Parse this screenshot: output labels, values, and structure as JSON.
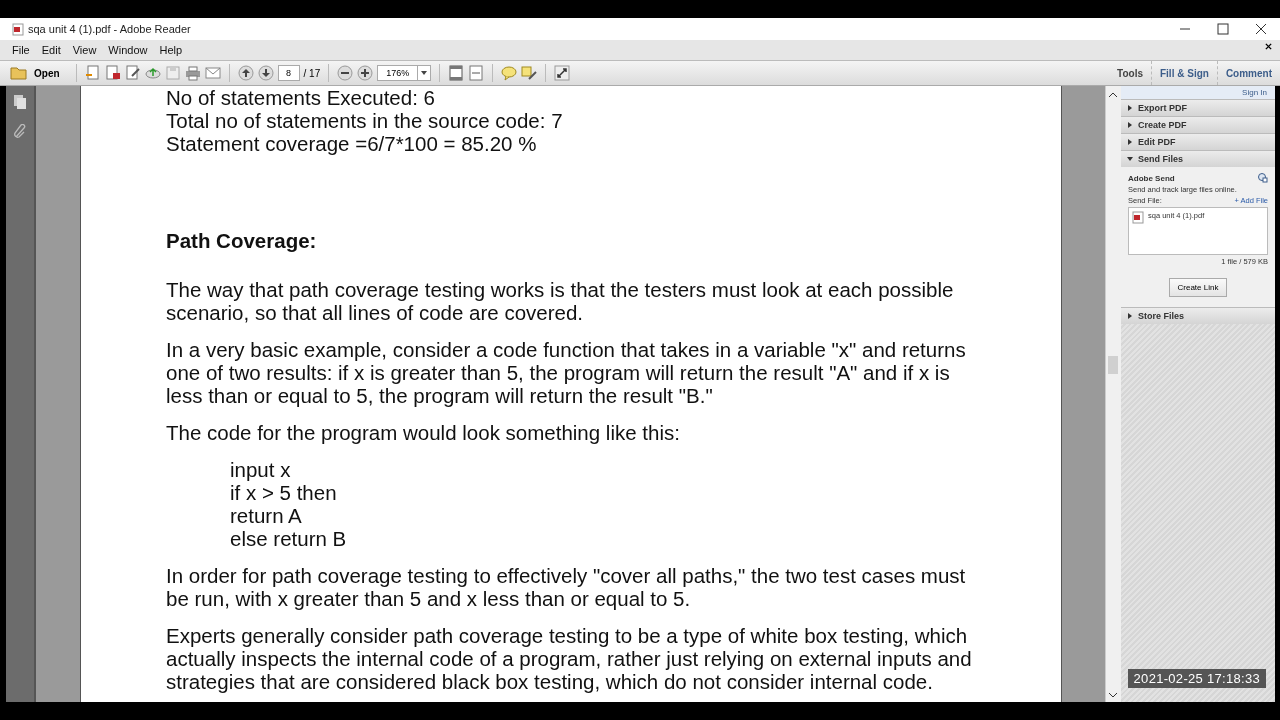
{
  "window": {
    "title": "sqa unit 4 (1).pdf - Adobe Reader"
  },
  "menu": [
    "File",
    "Edit",
    "View",
    "Window",
    "Help"
  ],
  "toolbar": {
    "open": "Open",
    "page": "8",
    "page_total": "/ 17",
    "zoom": "176%",
    "tabs": [
      {
        "label": "Tools",
        "selected": false
      },
      {
        "label": "Fill & Sign",
        "selected": false
      },
      {
        "label": "Comment",
        "selected": false
      }
    ]
  },
  "document": {
    "blocks": [
      {
        "kind": "line",
        "text": "No of statements Executed: 6"
      },
      {
        "kind": "line",
        "text": "Total no of statements in the source code: 7"
      },
      {
        "kind": "line",
        "text": "Statement coverage =6/7*100 = 85.20 %"
      },
      {
        "kind": "heading",
        "text": "Path Coverage:"
      },
      {
        "kind": "para",
        "text": "The way that path coverage testing works is that the testers must look at each possible scenario, so that all lines of code are covered."
      },
      {
        "kind": "para",
        "text": "In a very basic example, consider a code function that takes in a variable \"x\" and returns one of two results: if x is greater than 5, the program will return the result \"A\" and if x is less than or equal to 5, the program will return the result \"B.\""
      },
      {
        "kind": "para",
        "text": "The code for the program would look something like this:"
      },
      {
        "kind": "code",
        "lines": [
          "input x",
          "if x > 5 then",
          "return A",
          "else return B"
        ]
      },
      {
        "kind": "para",
        "text": "In order for path coverage testing to effectively \"cover all paths,\" the two test cases must be run, with x greater than 5 and x less than or equal to 5."
      },
      {
        "kind": "para",
        "text": "Experts generally consider path coverage testing to be a type of white box testing, which actually inspects the internal code of a program, rather just relying on external inputs and strategies that are considered black box testing, which do not consider internal code."
      }
    ]
  },
  "pane": {
    "sign_in": "Sign In",
    "sections": [
      {
        "label": "Export PDF",
        "expanded": false
      },
      {
        "label": "Create PDF",
        "expanded": false
      },
      {
        "label": "Edit PDF",
        "expanded": false
      },
      {
        "label": "Send Files",
        "expanded": true
      },
      {
        "label": "Store Files",
        "expanded": false
      }
    ],
    "send": {
      "title": "Adobe Send",
      "desc": "Send and track large files online.",
      "send_file_label": "Send File:",
      "add_file": "+ Add File",
      "file": "sqa unit 4 (1).pdf",
      "summary": "1 file / 579 KB",
      "button": "Create Link"
    }
  },
  "timestamp": "2021-02-25  17:18:33"
}
